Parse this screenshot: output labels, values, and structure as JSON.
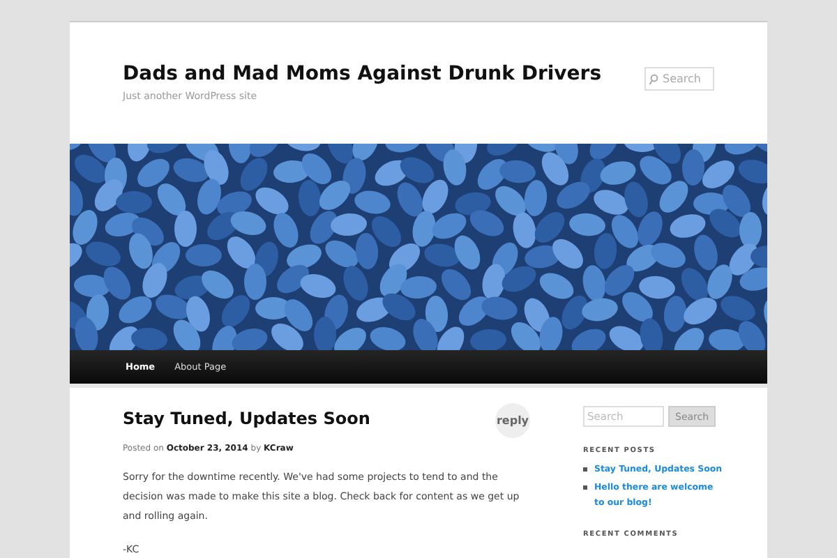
{
  "site": {
    "title": "Dads and Mad Moms Against Drunk Drivers",
    "tagline": "Just another WordPress site"
  },
  "header_search": {
    "placeholder": "Search"
  },
  "nav": [
    {
      "label": "Home",
      "selected": true
    },
    {
      "label": "About Page",
      "selected": false
    }
  ],
  "post": {
    "title": "Stay Tuned, Updates Soon",
    "reply": "reply",
    "meta_prefix": "Posted on",
    "date": "October 23, 2014",
    "meta_by": "by",
    "author": "KCraw",
    "paragraphs": [
      "Sorry for the downtime recently. We've had some projects to tend to and the decision was made to make this site a blog. Check back for content as we get up and rolling again.",
      "-KC"
    ]
  },
  "sidebar": {
    "search": {
      "placeholder": "Search",
      "button": "Search"
    },
    "recent_posts_heading": "RECENT POSTS",
    "recent_posts": [
      "Stay Tuned, Updates Soon",
      "Hello there are welcome to our blog!"
    ],
    "recent_comments_heading": "RECENT COMMENTS"
  }
}
